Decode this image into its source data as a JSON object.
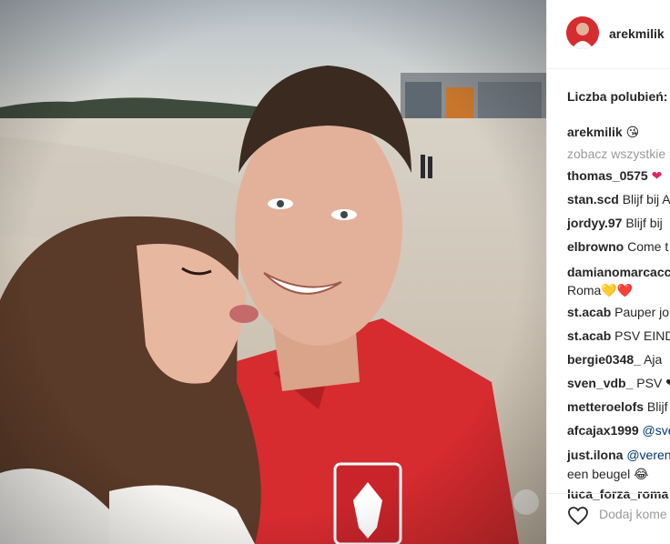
{
  "post": {
    "username": "arekmilik",
    "likes_label": "Liczba polubień:",
    "caption_user": "arekmilik",
    "caption_emoji": "😘",
    "see_all_label": "zobacz wszystkie"
  },
  "comments": [
    {
      "user": "thomas_0575",
      "text": "❤"
    },
    {
      "user": "stan.scd",
      "text": "Blijf bij A"
    },
    {
      "user": "jordyy.97",
      "text": "Blijf bij"
    },
    {
      "user": "elbrowno",
      "text": "Come t"
    },
    {
      "user": "damianomarcacc",
      "text": ""
    },
    {
      "user": "",
      "text": "Roma💛❤️"
    },
    {
      "user": "st.acab",
      "text": "Pauper jo"
    },
    {
      "user": "st.acab",
      "text": "PSV EIND"
    },
    {
      "user": "bergie0348_",
      "text": "Aja"
    },
    {
      "user": "sven_vdb_",
      "text": "PSV ❤"
    },
    {
      "user": "metteroelofs",
      "text": "Blijf"
    },
    {
      "user": "afcajax1999",
      "text": "@sve"
    },
    {
      "user": "just.ilona",
      "text": "@veren"
    },
    {
      "user": "",
      "text": "een beugel 😂"
    },
    {
      "user": "luca_forza_roma",
      "text": "😂"
    }
  ],
  "footer": {
    "add_comment_placeholder": "Dodaj kome"
  },
  "colors": {
    "jersey_red": "#d62b2f",
    "like_heart": "#e0245e",
    "muted_text": "#999999"
  }
}
